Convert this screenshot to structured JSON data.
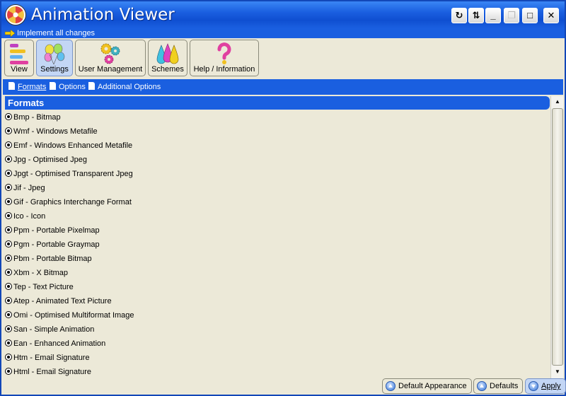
{
  "window": {
    "title": "Animation Viewer"
  },
  "implement": {
    "label": "Implement all changes"
  },
  "toolbar": [
    {
      "label": "View",
      "icon": "view-list-icon",
      "active": false
    },
    {
      "label": "Settings",
      "icon": "balloons-icon",
      "active": true
    },
    {
      "label": "User Management",
      "icon": "gears-icon",
      "active": false
    },
    {
      "label": "Schemes",
      "icon": "ink-drops-icon",
      "active": false
    },
    {
      "label": "Help / Information",
      "icon": "question-mark-icon",
      "active": false
    }
  ],
  "subtabs": [
    {
      "label": "Formats",
      "selected": true
    },
    {
      "label": "Options",
      "selected": false
    },
    {
      "label": "Additional Options",
      "selected": false
    }
  ],
  "section": {
    "title": "Formats"
  },
  "formats": [
    "Bmp - Bitmap",
    "Wmf - Windows Metafile",
    "Emf - Windows Enhanced Metafile",
    "Jpg - Optimised Jpeg",
    "Jpgt - Optimised Transparent Jpeg",
    "Jif - Jpeg",
    "Gif - Graphics Interchange Format",
    "Ico - Icon",
    "Ppm - Portable Pixelmap",
    "Pgm - Portable Graymap",
    "Pbm - Portable Bitmap",
    "Xbm - X Bitmap",
    "Tep - Text Picture",
    "Atep - Animated Text Picture",
    "Omi - Optimised Multiformat Image",
    "San - Simple Animation",
    "Ean - Enhanced Animation",
    "Htm - Email Signature",
    "Html - Email Signature"
  ],
  "buttons": {
    "default_appearance": "Default Appearance",
    "defaults": "Defaults",
    "apply": "Apply"
  },
  "colors": {
    "accent": "#1a5fe0",
    "active_tool": "#c3d6f5",
    "face": "#ece9d8"
  }
}
